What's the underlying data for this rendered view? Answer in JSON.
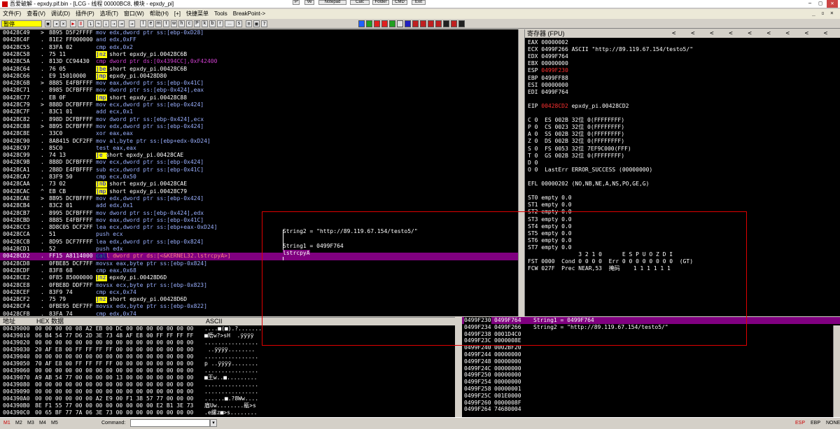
{
  "window": {
    "title": "吾爱破解 - epxdy.pif.bin - [LCG - 线程 00000BC8, 模块 - epxdy_pi]",
    "top_buttons": [
      "P",
      "Ve",
      "Notepad",
      "Calc",
      "Folder",
      "CMD",
      "Exit"
    ]
  },
  "menu": {
    "items": [
      "文件(F)",
      "查看(V)",
      "调试(D)",
      "插件(P)",
      "选项(T)",
      "窗口(W)",
      "帮助(H)",
      "[+]",
      "快捷菜单",
      "Tools",
      "BreakPoint->"
    ]
  },
  "toolbar": {
    "status": "暂停",
    "letters": [
      "l",
      "e",
      "m",
      "t",
      "w",
      "h",
      "c",
      "P",
      "k",
      "b",
      "r",
      "...",
      "s"
    ]
  },
  "cpu": {
    "rows": [
      {
        "addr": "00428C49",
        "m": ">",
        "hex": "8B95 D5F2FFFF",
        "ins": "mov edx,dword ptr ss:[ebp-0xD28]",
        "k": "mov"
      },
      {
        "addr": "00428C4F",
        "m": ".",
        "hex": "81E2 FF000000",
        "ins": "and edx,0xFF",
        "k": "mov"
      },
      {
        "addr": "00428C55",
        "m": ".",
        "hex": "83FA 02",
        "ins": "cmp edx,0x2",
        "k": "mov"
      },
      {
        "addr": "00428C58",
        "m": ".",
        "hex": "75 11",
        "ins": "jnz short epxdy_pi.00428C6B",
        "k": "jcc"
      },
      {
        "addr": "00428C5A",
        "m": ".",
        "hex": "813D CC94430",
        "ins": "cmp dword ptr ds:[0x4394CC],0xF42400",
        "k": "cmpred"
      },
      {
        "addr": "00428C64",
        "m": ".",
        "hex": "76 05",
        "ins": "jbe short epxdy_pi.00428C6B",
        "k": "jcc"
      },
      {
        "addr": "00428C66",
        "m": ".",
        "hex": "E9 15010000",
        "ins": "jmp epxdy_pi.00428D80",
        "k": "jmp"
      },
      {
        "addr": "00428C6B",
        "m": ">",
        "hex": "8B85 E4FBFFFF",
        "ins": "mov eax,dword ptr ss:[ebp-0x41C]",
        "k": "mov"
      },
      {
        "addr": "00428C71",
        "m": ".",
        "hex": "8985 DCFBFFFF",
        "ins": "mov dword ptr ss:[ebp-0x424],eax",
        "k": "mov"
      },
      {
        "addr": "00428C77",
        "m": ".",
        "hex": "EB 0F",
        "ins": "jmp short epxdy_pi.00428C88",
        "k": "jmp"
      },
      {
        "addr": "00428C79",
        "m": ">",
        "hex": "8B8D DCFBFFFF",
        "ins": "mov ecx,dword ptr ss:[ebp-0x424]",
        "k": "mov"
      },
      {
        "addr": "00428C7F",
        "m": ".",
        "hex": "83C1 01",
        "ins": "add ecx,0x1",
        "k": "mov"
      },
      {
        "addr": "00428C82",
        "m": ".",
        "hex": "898D DCFBFFFF",
        "ins": "mov dword ptr ss:[ebp-0x424],ecx",
        "k": "mov"
      },
      {
        "addr": "00428C88",
        "m": ">",
        "hex": "8B95 DCFBFFFF",
        "ins": "mov edx,dword ptr ss:[ebp-0x424]",
        "k": "mov"
      },
      {
        "addr": "00428C8E",
        "m": ".",
        "hex": "33C0",
        "ins": "xor eax,eax",
        "k": "mov"
      },
      {
        "addr": "00428C90",
        "m": ".",
        "hex": "8A8415 DCF2FF",
        "ins": "mov al,byte ptr ss:[ebp+edx-0xD24]",
        "k": "mov"
      },
      {
        "addr": "00428C97",
        "m": ".",
        "hex": "85C0",
        "ins": "test eax,eax",
        "k": "mov"
      },
      {
        "addr": "00428C99",
        "m": ".",
        "hex": "74 13",
        "ins": "je short epxdy_pi.00428CAE",
        "k": "jcc"
      },
      {
        "addr": "00428C9B",
        "m": ".",
        "hex": "8B8D DCFBFFFF",
        "ins": "mov ecx,dword ptr ss:[ebp-0x424]",
        "k": "mov"
      },
      {
        "addr": "00428CA1",
        "m": ".",
        "hex": "2B8D E4FBFFFF",
        "ins": "sub ecx,dword ptr ss:[ebp-0x41C]",
        "k": "mov"
      },
      {
        "addr": "00428CA7",
        "m": ".",
        "hex": "83F9 50",
        "ins": "cmp ecx,0x50",
        "k": "mov"
      },
      {
        "addr": "00428CAA",
        "m": ".",
        "hex": "73 02",
        "ins": "jnb short epxdy_pi.00428CAE",
        "k": "jcc"
      },
      {
        "addr": "00428CAC",
        "m": "^",
        "hex": "EB CB",
        "ins": "jmp short epxdy_pi.00428C79",
        "k": "jmp"
      },
      {
        "addr": "00428CAE",
        "m": ">",
        "hex": "8B95 DCFBFFFF",
        "ins": "mov edx,dword ptr ss:[ebp-0x424]",
        "k": "mov"
      },
      {
        "addr": "00428CB4",
        "m": ".",
        "hex": "83C2 01",
        "ins": "add edx,0x1",
        "k": "mov"
      },
      {
        "addr": "00428CB7",
        "m": ".",
        "hex": "8995 DCFBFFFF",
        "ins": "mov dword ptr ss:[ebp-0x424],edx",
        "k": "mov"
      },
      {
        "addr": "00428CBD",
        "m": ".",
        "hex": "8B85 E4FBFFFF",
        "ins": "mov eax,dword ptr ss:[ebp-0x41C]",
        "k": "mov"
      },
      {
        "addr": "00428CC3",
        "m": ".",
        "hex": "8D8C05 DCF2FF",
        "ins": "lea ecx,dword ptr ss:[ebp+eax-0xD24]",
        "k": "mov"
      },
      {
        "addr": "00428CCA",
        "m": ".",
        "hex": "51",
        "ins": "push ecx",
        "k": "mov"
      },
      {
        "addr": "00428CCB",
        "m": ".",
        "hex": "8D95 DCF7FFFF",
        "ins": "lea edx,dword ptr ss:[ebp-0x824]",
        "k": "mov"
      },
      {
        "addr": "00428CD1",
        "m": ".",
        "hex": "52",
        "ins": "push edx",
        "k": "mov"
      },
      {
        "addr": "00428CD2",
        "m": ".",
        "hex": "FF15 A8114000",
        "ins": "call dword ptr ds:[<&KERNEL32.lstrcpyA>]",
        "k": "call",
        "sel": true
      },
      {
        "addr": "00428CD8",
        "m": ".",
        "hex": "0FBE85 DCF7FF",
        "ins": "movsx eax,byte ptr ss:[ebp-0x824]",
        "k": "mov"
      },
      {
        "addr": "00428CDF",
        "m": ".",
        "hex": "83F8 68",
        "ins": "cmp eax,0x68",
        "k": "mov"
      },
      {
        "addr": "00428CE2",
        "m": ".",
        "hex": "0F85 85000000",
        "ins": "jnz epxdy_pi.00428D6D",
        "k": "jcc"
      },
      {
        "addr": "00428CE8",
        "m": ".",
        "hex": "0FBE8D DDF7FF",
        "ins": "movsx ecx,byte ptr ss:[ebp-0x823]",
        "k": "mov"
      },
      {
        "addr": "00428CEF",
        "m": ".",
        "hex": "83F9 74",
        "ins": "cmp ecx,0x74",
        "k": "mov"
      },
      {
        "addr": "00428CF2",
        "m": ".",
        "hex": "75 79",
        "ins": "jnz short epxdy_pi.00428D6D",
        "k": "jcc"
      },
      {
        "addr": "00428CF4",
        "m": ".",
        "hex": "0FBE95 DEF7FF",
        "ins": "movsx edx,byte ptr ss:[ebp-0x822]",
        "k": "mov"
      },
      {
        "addr": "00428CFB",
        "m": ".",
        "hex": "83FA 74",
        "ins": "cmp edx,0x74",
        "k": "mov"
      }
    ],
    "hint_lines": [
      "String2 = \"http://89.119.67.154/testo5/\"",
      "String1 = 0499F764",
      "lstrcpyA"
    ]
  },
  "registers": {
    "header": "寄存器 (FPU)",
    "lines": [
      {
        "t": "EAX 00000002"
      },
      {
        "t": "ECX 0499F266 ASCII \"http://89.119.67.154/testo5/\""
      },
      {
        "t": "EDX 0499F764"
      },
      {
        "t": "EBX 00000000"
      },
      {
        "pre": "ESP ",
        "red": "0499F230"
      },
      {
        "t": "EBP 0499FF88"
      },
      {
        "t": "ESI 00000000"
      },
      {
        "t": "EDI 0499F764"
      },
      {
        "t": ""
      },
      {
        "pre": "EIP ",
        "red": "00428CD2",
        "post": " epxdy_pi.00428CD2"
      },
      {
        "t": ""
      },
      {
        "t": "C 0  ES 002B 32位 0(FFFFFFFF)"
      },
      {
        "t": "P 0  CS 0023 32位 0(FFFFFFFF)"
      },
      {
        "t": "A 0  SS 002B 32位 0(FFFFFFFF)"
      },
      {
        "t": "Z 0  DS 002B 32位 0(FFFFFFFF)"
      },
      {
        "t": "S 0  FS 0053 32位 7EF9C000(FFF)"
      },
      {
        "t": "T 0  GS 002B 32位 0(FFFFFFFF)"
      },
      {
        "t": "D 0"
      },
      {
        "t": "O 0  LastErr ERROR_SUCCESS (00000000)"
      },
      {
        "t": ""
      },
      {
        "t": "EFL 00000202 (NO,NB,NE,A,NS,PO,GE,G)"
      },
      {
        "t": ""
      },
      {
        "t": "ST0 empty 0.0"
      },
      {
        "t": "ST1 empty 0.0"
      },
      {
        "t": "ST2 empty 0.0"
      },
      {
        "t": "ST3 empty 0.0"
      },
      {
        "t": "ST4 empty 0.0"
      },
      {
        "t": "ST5 empty 0.0"
      },
      {
        "t": "ST6 empty 0.0"
      },
      {
        "t": "ST7 empty 0.0"
      },
      {
        "t": "               3 2 1 0      E S P U O Z D I"
      },
      {
        "t": "FST 0000  Cond 0 0 0 0  Err 0 0 0 0 0 0 0 0  (GT)"
      },
      {
        "t": "FCW 027F  Prec NEAR,53  掩码    1 1 1 1 1 1"
      }
    ]
  },
  "dump": {
    "col_addr": "地址",
    "col_hex": "HEX 数据",
    "col_ascii": "ASCII",
    "rows": [
      {
        "a": "00439000",
        "h": "00 00 00 00 08 A2 EB 00 DC 00 00 00 00 00 00 00",
        "s": "....■(■).?......."
      },
      {
        "a": "00439010",
        "h": "06 B4 54 77 D6 2D 3E 73 48 AF E8 00 FF FF FF FF",
        "s": "■晤w?>sH  .ÿÿÿÿ"
      },
      {
        "a": "00439020",
        "h": "00 00 00 00 00 00 00 00 00 00 00 00 00 00 00 00",
        "s": "................"
      },
      {
        "a": "00439030",
        "h": "20 AF E8 00 FF FF FF FF 00 00 00 00 00 00 00 00",
        "s": " ..ÿÿÿÿ........"
      },
      {
        "a": "00439040",
        "h": "00 00 00 00 00 00 00 00 00 00 00 00 00 00 00 00",
        "s": "................"
      },
      {
        "a": "00439050",
        "h": "70 AF E8 00 FF FF FF FF 00 00 00 00 00 00 00 00",
        "s": "p ..ÿÿÿÿ........"
      },
      {
        "a": "00439060",
        "h": "00 00 00 00 00 00 00 00 00 00 00 00 00 00 00 00",
        "s": "................"
      },
      {
        "a": "00439070",
        "h": "A9 AB 54 77 00 00 00 00 13 00 00 00 00 00 00 00",
        "s": "■王w..■........."
      },
      {
        "a": "00439080",
        "h": "00 00 00 00 00 00 00 00 00 00 00 00 00 00 00 00",
        "s": "................"
      },
      {
        "a": "00439090",
        "h": "00 00 00 00 00 00 00 00 00 00 00 00 00 00 00 00",
        "s": "................"
      },
      {
        "a": "004390A0",
        "h": "00 00 00 00 00 00 A2 E9 00 F1 38 57 77 00 00 00",
        "s": "......■.?8Ww...."
      },
      {
        "a": "004390B0",
        "h": "8E F1 55 77 00 00 00 00 00 00 00 00 E2 B1 3E 73",
        "s": "庮Uw........瓹>s"
      },
      {
        "a": "004390C0",
        "h": "00 65 BF 77 7A 06 3E 73 00 00 00 00 00 00 00 00",
        "s": ".e縲z■>s........"
      }
    ]
  },
  "stack": {
    "rows": [
      {
        "a": "0499F230",
        "v": "0499F764",
        "c": "String1 = 0499F764",
        "sel": true
      },
      {
        "a": "0499F234",
        "v": "0499F266",
        "c": "String2 = \"http://89.119.67.154/testo5/\""
      },
      {
        "a": "0499F238",
        "v": "0001D4C0",
        "c": ""
      },
      {
        "a": "0499F23C",
        "v": "0000008E",
        "c": ""
      },
      {
        "a": "0499F240",
        "v": "0002BF20",
        "c": ""
      },
      {
        "a": "0499F244",
        "v": "00000000",
        "c": ""
      },
      {
        "a": "0499F248",
        "v": "00000000",
        "c": ""
      },
      {
        "a": "0499F24C",
        "v": "00000000",
        "c": ""
      },
      {
        "a": "0499F250",
        "v": "00000000",
        "c": ""
      },
      {
        "a": "0499F254",
        "v": "00000000",
        "c": ""
      },
      {
        "a": "0499F258",
        "v": "00000001",
        "c": ""
      },
      {
        "a": "0499F25C",
        "v": "001E0000",
        "c": ""
      },
      {
        "a": "0499F260",
        "v": "0000008F",
        "c": ""
      },
      {
        "a": "0499F264",
        "v": "74680004",
        "c": ""
      }
    ]
  },
  "statusbar": {
    "buttons": [
      "M1",
      "M2",
      "M3",
      "M4",
      "M5"
    ],
    "command_label": "Command:",
    "right": [
      "ESP",
      "EBP",
      "NONE"
    ]
  },
  "colors": {
    "selection": "#800080",
    "jump": "#ffff00",
    "call": "#c00000",
    "annotation": "#e00000"
  }
}
